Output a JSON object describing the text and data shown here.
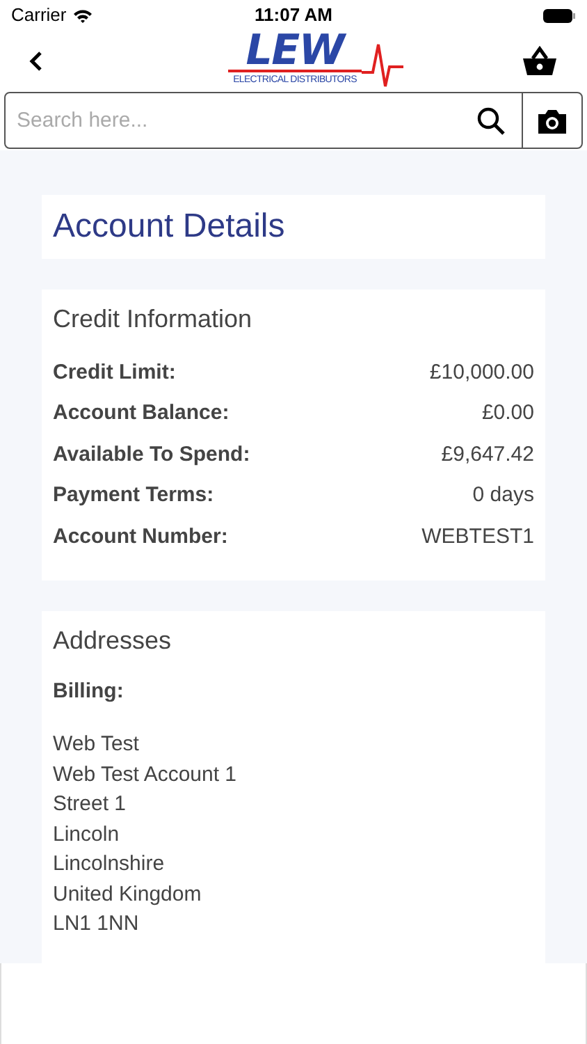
{
  "status_bar": {
    "carrier": "Carrier",
    "time": "11:07 AM"
  },
  "logo": {
    "name": "LEW",
    "tagline": "ELECTRICAL DISTRIBUTORS"
  },
  "search": {
    "placeholder": "Search here..."
  },
  "title": "Account Details",
  "credit": {
    "heading": "Credit Information",
    "rows": [
      {
        "label": "Credit Limit:",
        "value": "£10,000.00"
      },
      {
        "label": "Account Balance:",
        "value": "£0.00"
      },
      {
        "label": "Available To Spend:",
        "value": "£9,647.42"
      },
      {
        "label": "Payment Terms:",
        "value": "0 days"
      },
      {
        "label": "Account Number:",
        "value": "WEBTEST1"
      }
    ]
  },
  "addresses": {
    "heading": "Addresses",
    "billing_label": "Billing:",
    "billing_lines": [
      "Web Test",
      "Web Test Account 1",
      "Street 1",
      "Lincoln",
      "Lincolnshire",
      "United Kingdom",
      "LN1 1NN"
    ]
  }
}
